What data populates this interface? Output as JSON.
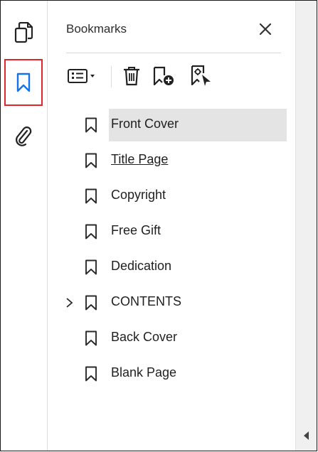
{
  "panel": {
    "title": "Bookmarks"
  },
  "left_toolbar": {
    "items": [
      {
        "icon": "pages-icon"
      },
      {
        "icon": "bookmark-icon",
        "active": true
      },
      {
        "icon": "attachment-icon"
      }
    ]
  },
  "toolbar": {
    "icons": [
      "options-menu-icon",
      "delete-bookmark-icon",
      "new-bookmark-icon",
      "expand-bookmark-icon"
    ]
  },
  "bookmarks": [
    {
      "label": "Front Cover",
      "selected": true
    },
    {
      "label": "Title Page"
    },
    {
      "label": "Copyright"
    },
    {
      "label": "Free Gift"
    },
    {
      "label": "Dedication"
    },
    {
      "label": "CONTENTS",
      "expandable": true
    },
    {
      "label": "Back Cover"
    },
    {
      "label": "Blank Page"
    }
  ],
  "colors": {
    "active_outline": "#e0252b",
    "accent_blue": "#1473e6",
    "selected_row": "#e4e4e4"
  }
}
